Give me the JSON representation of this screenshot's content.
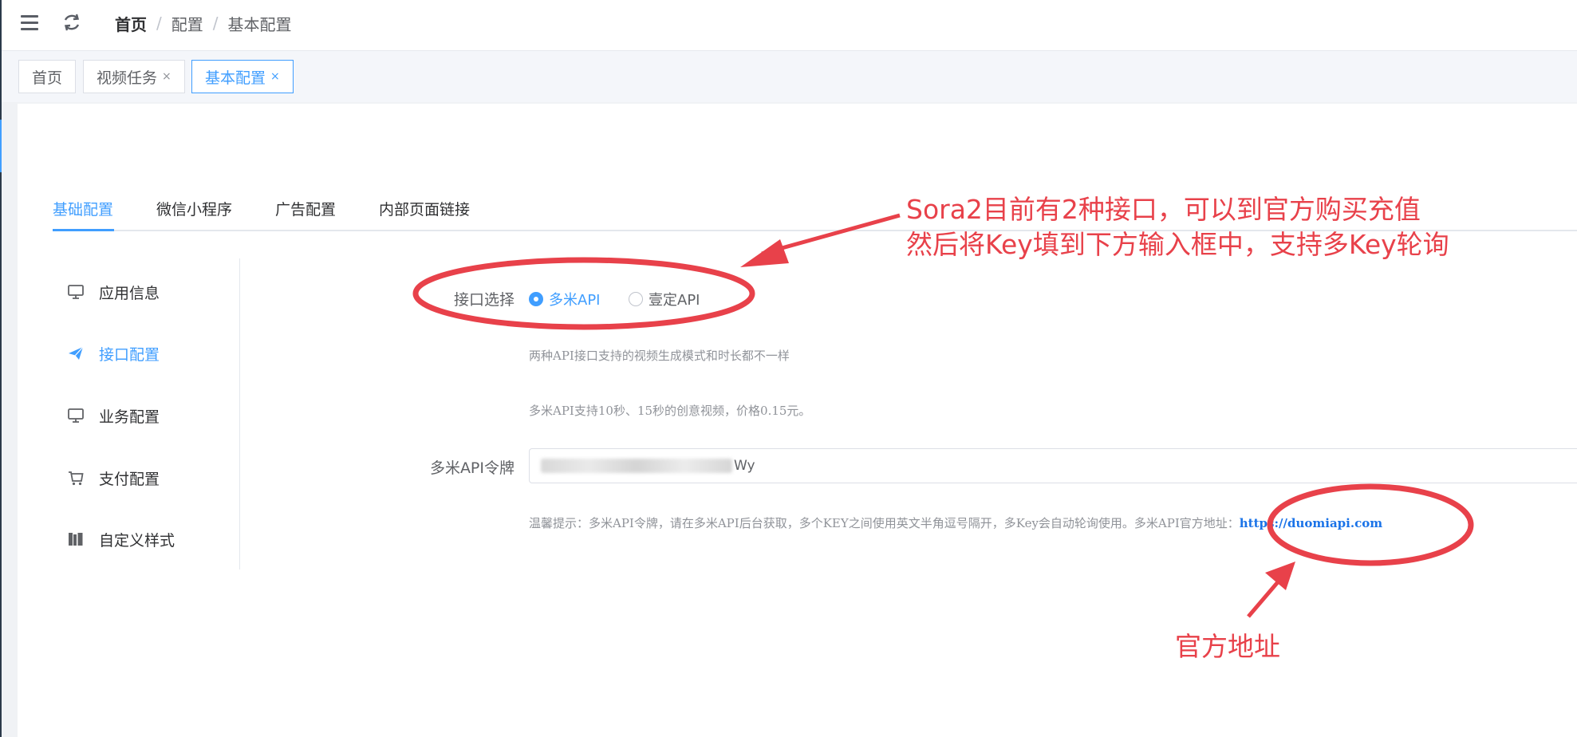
{
  "breadcrumb": [
    "首页",
    "配置",
    "基本配置"
  ],
  "tags": [
    {
      "label": "首页",
      "closable": false
    },
    {
      "label": "视频任务",
      "closable": true
    },
    {
      "label": "基本配置",
      "closable": true,
      "active": true
    }
  ],
  "close_glyph": "×",
  "tabs": [
    "基础配置",
    "微信小程序",
    "广告配置",
    "内部页面链接"
  ],
  "side_menu": [
    {
      "label": "应用信息",
      "icon": "monitor-icon"
    },
    {
      "label": "接口配置",
      "icon": "paper-plane-icon",
      "active": true
    },
    {
      "label": "业务配置",
      "icon": "monitor-icon"
    },
    {
      "label": "支付配置",
      "icon": "cart-icon"
    },
    {
      "label": "自定义样式",
      "icon": "books-icon"
    }
  ],
  "form": {
    "interface_label": "接口选择",
    "options": [
      "多米API",
      "壹定API"
    ],
    "selected": "多米API",
    "hint1": "两种API接口支持的视频生成模式和时长都不一样",
    "hint2": "多米API支持10秒、15秒的创意视频，价格0.15元。",
    "token_label": "多米API令牌",
    "token_visible_suffix": "Wy",
    "tip_text": "温馨提示：多米API令牌，请在多米API后台获取，多个KEY之间使用英文半角逗号隔开，多Key会自动轮询使用。多米API官方地址：",
    "tip_link": "https://duomiapi.com"
  },
  "annotations": {
    "note_line1": "Sora2目前有2种接口，可以到官方购买充值",
    "note_line2": "然后将Key填到下方输入框中，支持多Key轮询",
    "note_official": "官方地址"
  },
  "colors": {
    "accent": "#409eff",
    "annotation": "#e8414a"
  }
}
